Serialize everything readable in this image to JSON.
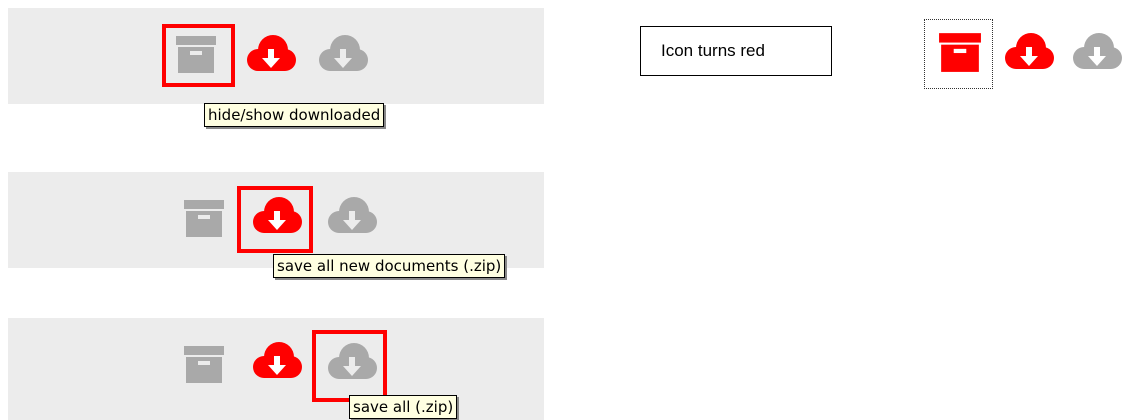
{
  "colors": {
    "panel_bg": "#ececec",
    "icon_gray": "#a9a9a9",
    "icon_red": "#ff0000",
    "highlight": "#ff0000",
    "tooltip_bg": "#ffffe1"
  },
  "icons": {
    "archive": "archive-box-icon",
    "save_new": "cloud-download-icon",
    "save_all": "cloud-download-icon"
  },
  "tooltips": {
    "hide_show": "hide/show downloaded",
    "save_new": "save all new documents (.zip)",
    "save_all": "save all (.zip)"
  },
  "note": {
    "text": "Icon turns red"
  }
}
